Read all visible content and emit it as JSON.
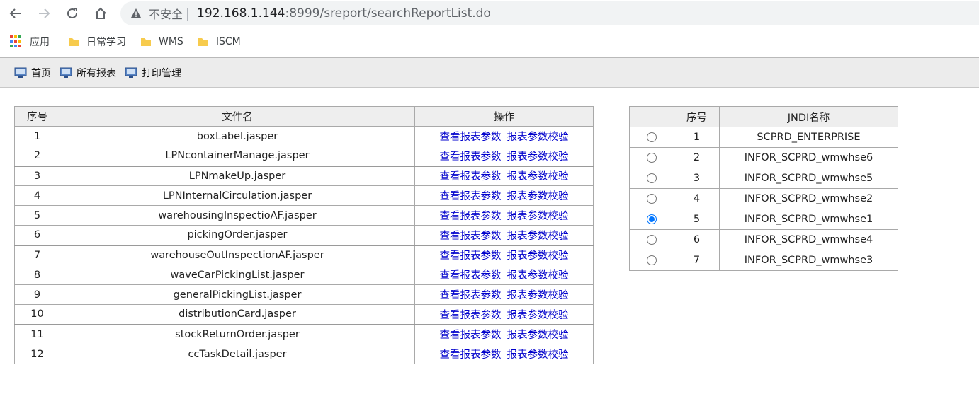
{
  "browser": {
    "security_label": "不安全",
    "url_host": "192.168.1.144",
    "url_rest": ":8999/sreport/searchReportList.do"
  },
  "bookmarks": {
    "apps_label": "应用",
    "items": [
      "日常学习",
      "WMS",
      "ISCM"
    ]
  },
  "toolbar": {
    "items": [
      "首页",
      "所有报表",
      "打印管理"
    ]
  },
  "report_table": {
    "headers": {
      "no": "序号",
      "file": "文件名",
      "op": "操作"
    },
    "op_view": "查看报表参数",
    "op_validate": "报表参数校验",
    "rows": [
      {
        "no": "1",
        "file": "boxLabel.jasper"
      },
      {
        "no": "2",
        "file": "LPNcontainerManage.jasper"
      },
      {
        "no": "3",
        "file": "LPNmakeUp.jasper"
      },
      {
        "no": "4",
        "file": "LPNInternalCirculation.jasper"
      },
      {
        "no": "5",
        "file": "warehousingInspectioAF.jasper"
      },
      {
        "no": "6",
        "file": "pickingOrder.jasper"
      },
      {
        "no": "7",
        "file": "warehouseOutInspectionAF.jasper"
      },
      {
        "no": "8",
        "file": "waveCarPickingList.jasper"
      },
      {
        "no": "9",
        "file": "generalPickingList.jasper"
      },
      {
        "no": "10",
        "file": "distributionCard.jasper"
      },
      {
        "no": "11",
        "file": "stockReturnOrder.jasper"
      },
      {
        "no": "12",
        "file": "ccTaskDetail.jasper"
      }
    ]
  },
  "jndi_table": {
    "headers": {
      "select": "",
      "no": "序号",
      "name": "JNDI名称"
    },
    "rows": [
      {
        "no": "1",
        "name": "SCPRD_ENTERPRISE",
        "selected": false
      },
      {
        "no": "2",
        "name": "INFOR_SCPRD_wmwhse6",
        "selected": false
      },
      {
        "no": "3",
        "name": "INFOR_SCPRD_wmwhse5",
        "selected": false
      },
      {
        "no": "4",
        "name": "INFOR_SCPRD_wmwhse2",
        "selected": false
      },
      {
        "no": "5",
        "name": "INFOR_SCPRD_wmwhse1",
        "selected": true
      },
      {
        "no": "6",
        "name": "INFOR_SCPRD_wmwhse4",
        "selected": false
      },
      {
        "no": "7",
        "name": "INFOR_SCPRD_wmwhse3",
        "selected": false
      }
    ]
  },
  "colors": {
    "link": "#0000cc",
    "radio_checked": "#0075ff",
    "toolbar_bg": "#ececec"
  }
}
